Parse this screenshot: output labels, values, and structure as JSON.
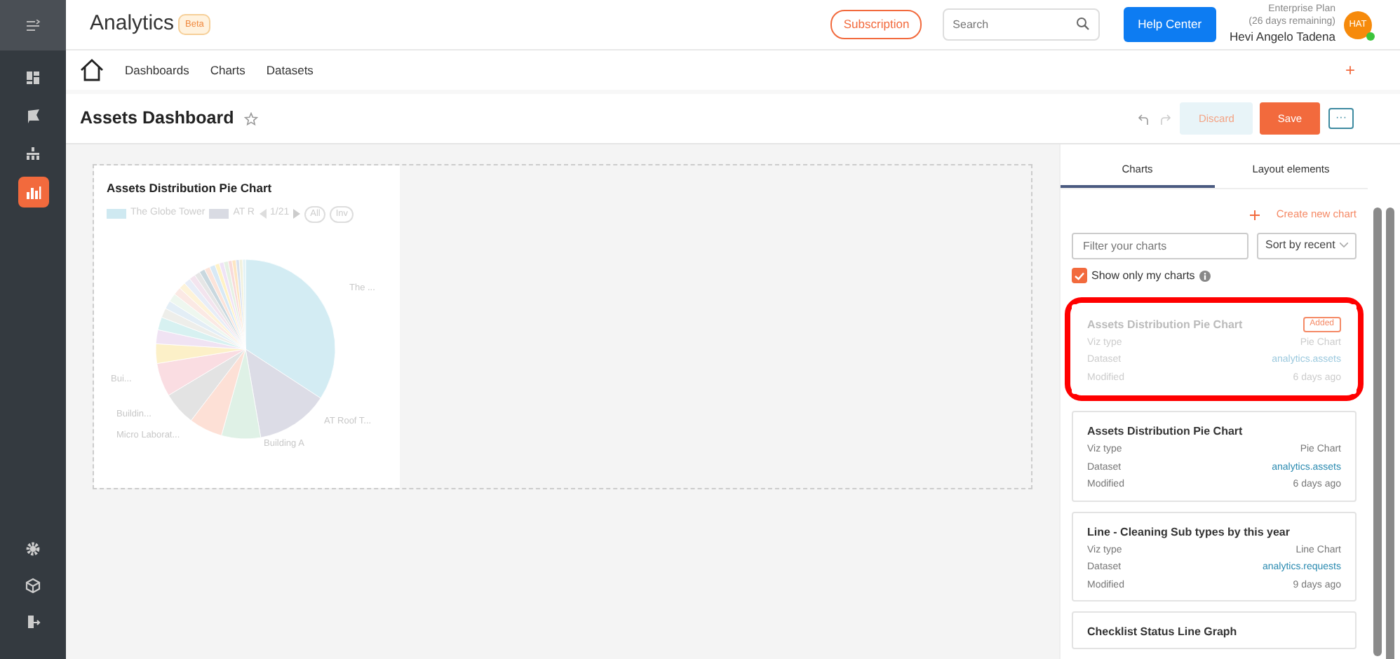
{
  "header": {
    "app_title": "Analytics",
    "badge": "Beta",
    "subscription_button": "Subscription",
    "search": {
      "placeholder": "Search"
    },
    "help_button": "Help Center",
    "user": {
      "plan": "Enterprise Plan",
      "remaining": "(26 days remaining)",
      "name": "Hevi Angelo Tadena",
      "initials": "HAT",
      "online": true
    }
  },
  "sidebar": {
    "items": [
      {
        "selected": false
      },
      {
        "selected": false
      },
      {
        "selected": false
      },
      {
        "selected": true
      }
    ]
  },
  "nav": {
    "links": [
      "Dashboards",
      "Charts",
      "Datasets"
    ],
    "add_button": "+"
  },
  "toolbar": {
    "title": "Assets Dashboard",
    "starred": false,
    "discard_button": "Discard",
    "save_button": "Save",
    "more_button": "···"
  },
  "chart_card": {
    "title": "Assets Distribution Pie Chart",
    "legend": [
      {
        "label": "The Globe Tower",
        "color": "#cfe9f1"
      },
      {
        "label": "AT R",
        "color": "#d9dbe3"
      }
    ],
    "pager": "1/21",
    "legend_buttons": [
      "All",
      "Inv"
    ],
    "slice_labels": [
      "The ...",
      "Bui...",
      "Buildin...",
      "AT Roof T...",
      "Micro Laborat...",
      "Building A"
    ]
  },
  "panel": {
    "tabs": [
      {
        "label": "Charts",
        "selected": true
      },
      {
        "label": "Layout elements",
        "selected": false
      }
    ],
    "create_link": "Create new chart",
    "filter": {
      "placeholder": "Filter your charts"
    },
    "sort": {
      "value": "Sort by recent"
    },
    "show_only_mine": {
      "label": "Show only my charts",
      "checked": true
    },
    "cards": [
      {
        "title": "Assets Distribution Pie Chart",
        "badge": "Added",
        "added": true,
        "highlighted": true,
        "rows": [
          {
            "label": "Viz type",
            "value": "Pie Chart",
            "kind": "text"
          },
          {
            "label": "Dataset",
            "value": "analytics.assets",
            "kind": "link"
          },
          {
            "label": "Modified",
            "value": "6 days ago",
            "kind": "text"
          }
        ]
      },
      {
        "title": "Assets Distribution Pie Chart",
        "added": false,
        "highlighted": false,
        "rows": [
          {
            "label": "Viz type",
            "value": "Pie Chart",
            "kind": "text"
          },
          {
            "label": "Dataset",
            "value": "analytics.assets",
            "kind": "link"
          },
          {
            "label": "Modified",
            "value": "6 days ago",
            "kind": "text"
          }
        ]
      },
      {
        "title": "Line - Cleaning Sub types by this year",
        "added": false,
        "highlighted": false,
        "rows": [
          {
            "label": "Viz type",
            "value": "Line Chart",
            "kind": "text"
          },
          {
            "label": "Dataset",
            "value": "analytics.requests",
            "kind": "link"
          },
          {
            "label": "Modified",
            "value": "9 days ago",
            "kind": "text"
          }
        ]
      },
      {
        "title": "Checklist Status Line Graph",
        "added": false,
        "highlighted": false
      }
    ]
  }
}
